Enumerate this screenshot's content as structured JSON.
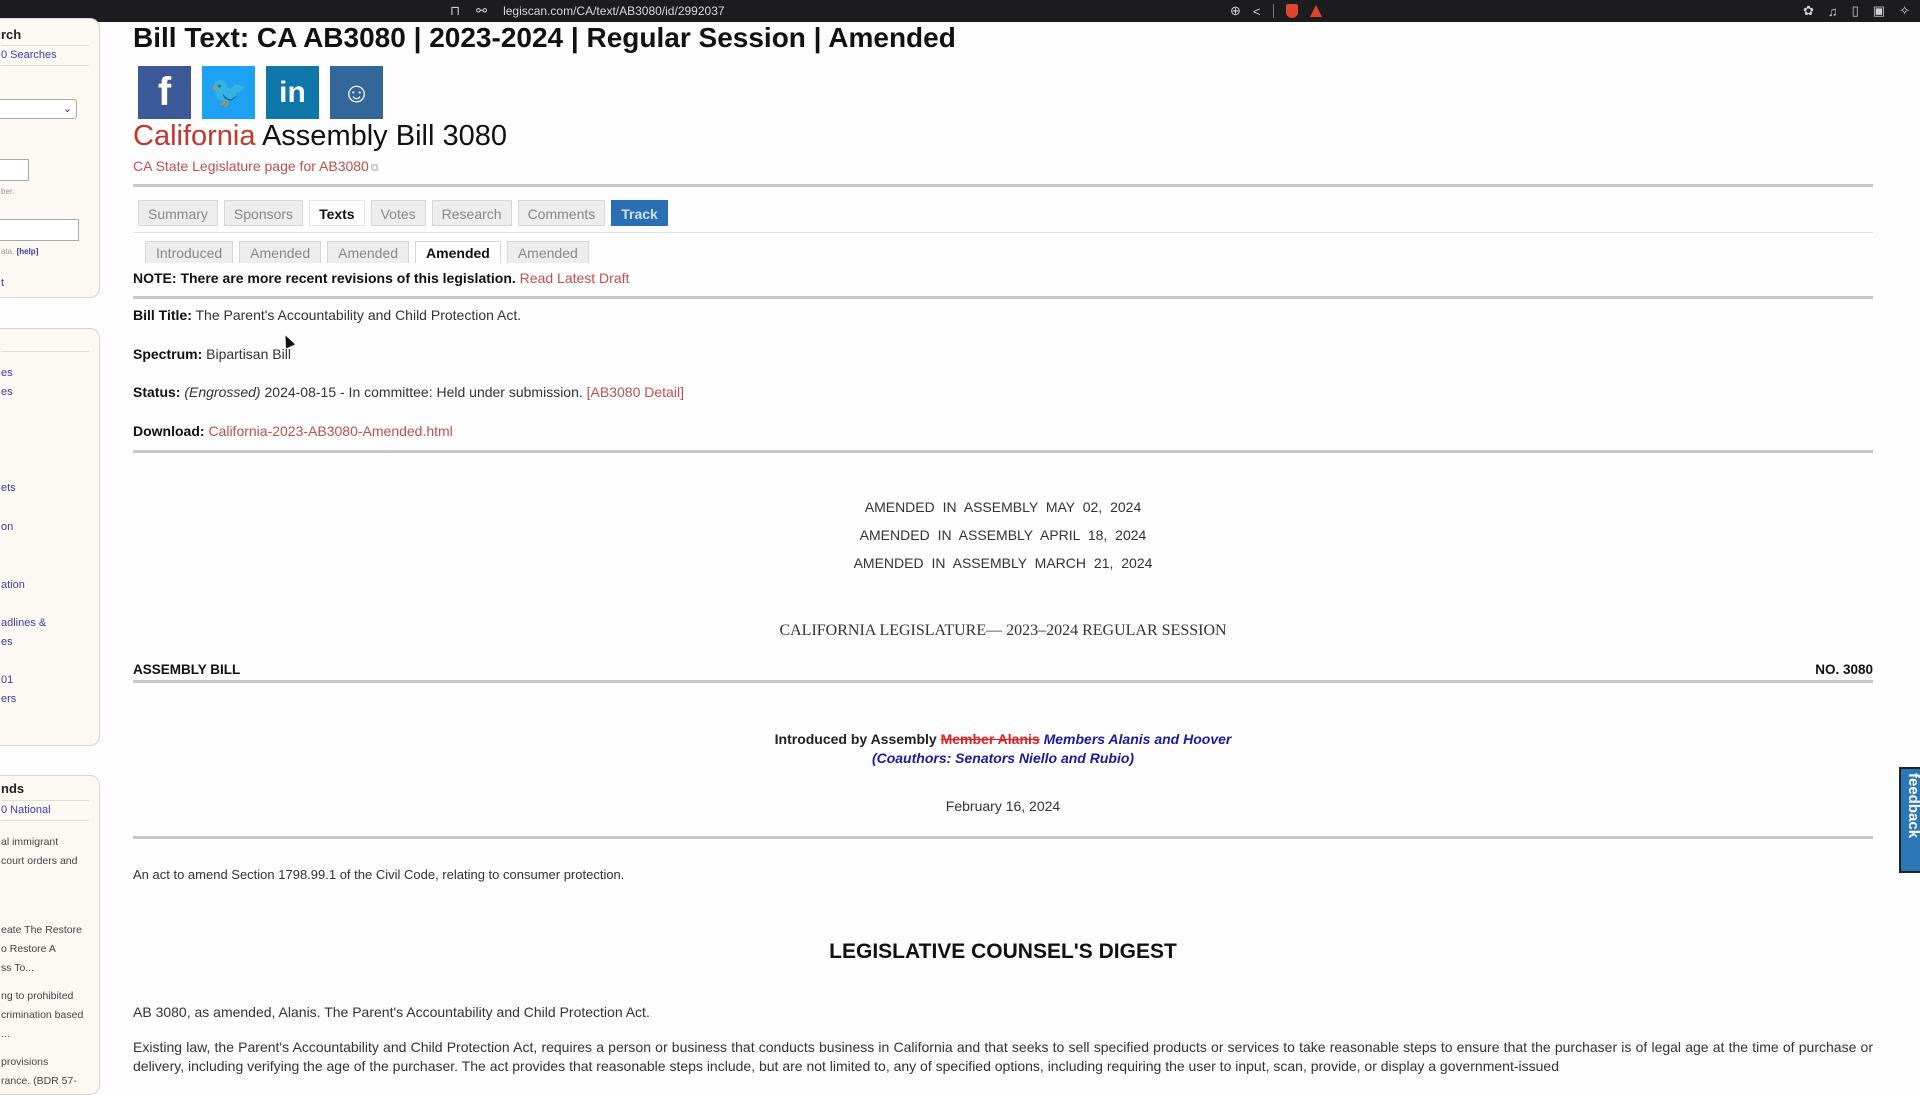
{
  "browser": {
    "url": "legiscan.com/CA/text/AB3080/id/2992037",
    "icons": [
      "bookmark-icon",
      "site-settings-icon",
      "zoom-icon",
      "share-icon",
      "brave-shield-icon",
      "brave-rewards-icon",
      "extensions-icon",
      "media-icon",
      "sidebar-icon",
      "wallet-icon",
      "leo-icon"
    ]
  },
  "sidebar": {
    "search_box": {
      "title": "rch",
      "saved_searches_link": "0 Searches",
      "number_hint": "ber.",
      "help_prefix": "ata.",
      "help_link": "[help]",
      "bottom_link": "t"
    },
    "links_box": {
      "title": "",
      "items": [
        "es",
        "es",
        "ets",
        "on",
        "ation",
        "adlines &",
        "es",
        "01",
        "ers"
      ]
    },
    "trends_box": {
      "title": "nds",
      "subtitle_link": "0 National",
      "items": [
        "al immigrant",
        " court orders and",
        "eate The Restore",
        "o Restore A",
        "ss To...",
        "ng to prohibited",
        "crimination based",
        "...",
        " provisions",
        "rance. (BDR 57-"
      ]
    }
  },
  "page": {
    "title": "Bill Text: CA AB3080 | 2023-2024 | Regular Session | Amended",
    "social": [
      {
        "name": "facebook",
        "glyph": "f"
      },
      {
        "name": "twitter",
        "glyph": "🐦"
      },
      {
        "name": "linkedin",
        "glyph": "in"
      },
      {
        "name": "reddit",
        "glyph": "☺"
      }
    ],
    "state": "California",
    "bill_name": "Assembly Bill 3080",
    "legislature_link": "CA State Legislature page for AB3080",
    "tabs": [
      "Summary",
      "Sponsors",
      "Texts",
      "Votes",
      "Research",
      "Comments",
      "Track"
    ],
    "active_tab": "Texts",
    "text_versions": [
      "Introduced",
      "Amended",
      "Amended",
      "Amended",
      "Amended"
    ],
    "active_version_index": 3,
    "note": "NOTE: There are more recent revisions of this legislation.",
    "note_link": "Read Latest Draft",
    "bill_title_label": "Bill Title:",
    "bill_title": "The Parent's Accountability and Child Protection Act.",
    "spectrum_label": "Spectrum:",
    "spectrum": "Bipartisan Bill",
    "status_label": "Status:",
    "status_stage": "(Engrossed)",
    "status_text": "2024-08-15 - In committee: Held under submission.",
    "status_link": "[AB3080 Detail]",
    "download_label": "Download:",
    "download_link": "California-2023-AB3080-Amended.html"
  },
  "bill_text": {
    "amendments": [
      "AMENDED IN ASSEMBLY MAY 02, 2024",
      "AMENDED IN ASSEMBLY APRIL 18, 2024",
      "AMENDED IN ASSEMBLY MARCH 21, 2024"
    ],
    "session": "CALIFORNIA LEGISLATURE— 2023–2024 REGULAR SESSION",
    "assembly_bill_label": "ASSEMBLY BILL",
    "bill_number": "NO. 3080",
    "introduced_prefix": "Introduced by Assembly",
    "introduced_struck": "Member Alanis",
    "introduced_inserted": "Members Alanis and Hoover",
    "coauthors": "(Coauthors: Senators Niello and Rubio)",
    "date": "February 16, 2024",
    "act_description": "An act to amend Section 1798.99.1 of the Civil Code, relating to consumer protection.",
    "digest_title": "LEGISLATIVE COUNSEL'S DIGEST",
    "digest_summary": "AB 3080, as amended, Alanis. The Parent's Accountability and Child Protection Act.",
    "digest_paragraph": "Existing law, the Parent's Accountability and Child Protection Act, requires a person or business that conducts business in California and that seeks to sell specified products or services to take reasonable steps to ensure that the purchaser is of legal age at the time of purchase or delivery, including verifying the age of the purchaser. The act provides that reasonable steps include, but are not limited to, any of specified options, including requiring the user to input, scan, provide, or display a government-issued"
  },
  "feedback_label": "feedback",
  "colors": {
    "link_red": "#c0504d",
    "state_red": "#c0392b",
    "track_blue": "#2a6fb3",
    "inserted_blue": "#1a1aa0",
    "struck_red": "#e02020",
    "feedback_blue": "#2a78b8"
  }
}
